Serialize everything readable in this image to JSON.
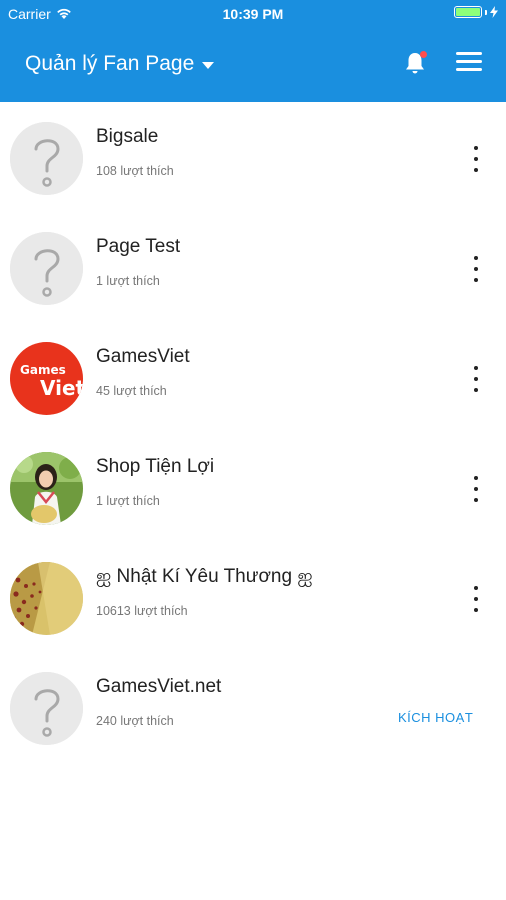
{
  "status_bar": {
    "carrier": "Carrier",
    "time": "10:39 PM"
  },
  "header": {
    "title": "Quản lý Fan Page",
    "icons": [
      "caret-down-icon",
      "bell-icon",
      "menu-icon"
    ]
  },
  "colors": {
    "header": "#1a8fdf",
    "accent": "#1a8fdf",
    "notification_dot": "#ff4d4d"
  },
  "pages": [
    {
      "name": "Bigsale",
      "likes": "108 lượt thích",
      "avatar": "placeholder"
    },
    {
      "name": "Page Test",
      "likes": "1 lượt thích",
      "avatar": "placeholder"
    },
    {
      "name": "GamesViet",
      "likes": "45 lượt thích",
      "avatar": "gamesviet-logo",
      "logo_text_top": "Games",
      "logo_text_bottom": "Viet"
    },
    {
      "name": "Shop Tiện Lợi",
      "likes": "1 lượt thích",
      "avatar": "photo-girl"
    },
    {
      "name": "ஐ Nhật Kí Yêu Thương ஐ",
      "likes": "10613 lượt thích",
      "avatar": "photo-hearts"
    },
    {
      "name": "GamesViet.net",
      "likes": "240 lượt thích",
      "avatar": "placeholder",
      "action": "KÍCH HOẠT"
    }
  ]
}
